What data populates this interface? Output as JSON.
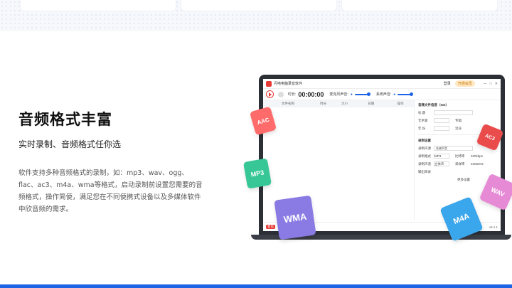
{
  "feature": {
    "title": "音频格式丰富",
    "subtitle": "实时录制、音频格式任你选",
    "description": "软件支持多种音频格式的录制，如：mp3、wav、ogg、flac、ac3、m4a、wma等格式，启动录制前设置您需要的音频格式，操作简便，满足您在不同便携式设备以及多媒体软件中欣音频的需求。"
  },
  "app": {
    "title": "闪电电脑录音软件",
    "login": "登录",
    "vip": "开通会员",
    "time_label": "时长:",
    "time": "00:00:00",
    "mic_label": "麦克风声音:",
    "sys_label": "系统声音:",
    "columns": [
      "文件名称",
      "时长",
      "大小",
      "日期",
      "操作"
    ],
    "meta_section": "音频文件信息（ID3）",
    "meta_fields": [
      "标  题",
      "艺术家",
      "专辑",
      "年  份",
      "流派"
    ],
    "record_section": "录制设置",
    "source_label": "录制声源",
    "source_value": "系统声音",
    "format_label": "录制格式",
    "format_value": "MP3",
    "bitrate_label": "比特率",
    "bitrate_value": "320kbps",
    "channel_label": "录制声道",
    "channel_value": "立体声",
    "sample_label": "采样率",
    "sample_value": "22050Hz",
    "output_label": "输出目录",
    "more_label": "更多设置",
    "status": "意见",
    "version": "v3.1.1"
  },
  "badges": [
    "AAC",
    "MP3",
    "WMA",
    "M4A",
    "AC3",
    "WAV"
  ],
  "colors": {
    "accent": "#1d63e6",
    "record": "#e53935"
  }
}
